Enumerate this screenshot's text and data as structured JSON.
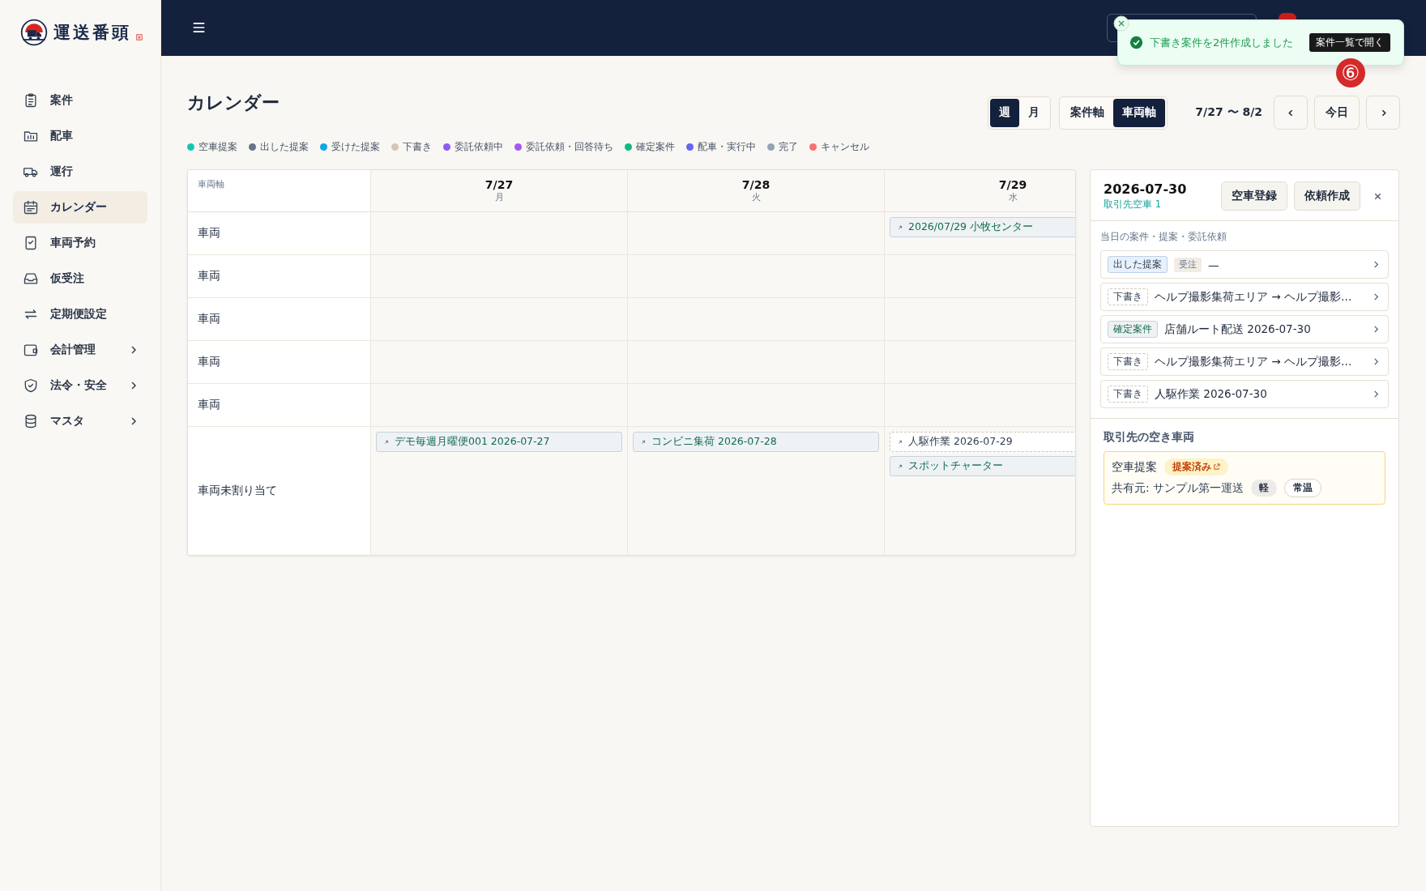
{
  "brand": {
    "name": "運送番頭"
  },
  "sidebar": {
    "items": [
      {
        "label": "案件",
        "kind": "clipboard",
        "selected": false,
        "expandable": false
      },
      {
        "label": "配車",
        "kind": "folder",
        "selected": false,
        "expandable": false
      },
      {
        "label": "運行",
        "kind": "truck",
        "selected": false,
        "expandable": false
      },
      {
        "label": "カレンダー",
        "kind": "calendar",
        "selected": true,
        "expandable": false
      },
      {
        "label": "車両予約",
        "kind": "check",
        "selected": false,
        "expandable": false
      },
      {
        "label": "仮受注",
        "kind": "inbox",
        "selected": false,
        "expandable": false
      },
      {
        "label": "定期便設定",
        "kind": "repeat",
        "selected": false,
        "expandable": false
      },
      {
        "label": "会計管理",
        "kind": "wallet",
        "selected": false,
        "expandable": true
      },
      {
        "label": "法令・安全",
        "kind": "shield",
        "selected": false,
        "expandable": true
      },
      {
        "label": "マスタ",
        "kind": "database",
        "selected": false,
        "expandable": true
      }
    ]
  },
  "toast": {
    "message": "下書き案件を2件作成しました",
    "action": "案件一覧で開く"
  },
  "step_marker": "⑥",
  "page": {
    "title": "カレンダー"
  },
  "view_toggle": [
    {
      "label": "週",
      "selected": true
    },
    {
      "label": "月",
      "selected": false
    }
  ],
  "axis_toggle": [
    {
      "label": "案件軸",
      "selected": false
    },
    {
      "label": "車両軸",
      "selected": true
    }
  ],
  "range": "7/27 〜 8/2",
  "today_button": "今日",
  "legend": [
    {
      "label": "空車提案",
      "color": "#14c8b0"
    },
    {
      "label": "出した提案",
      "color": "#64748b"
    },
    {
      "label": "受けた提案",
      "color": "#0ea5e9"
    },
    {
      "label": "下書き",
      "color": "#d6c7b4"
    },
    {
      "label": "委託依頼中",
      "color": "#8b5cf6"
    },
    {
      "label": "委託依頼・回答待ち",
      "color": "#a855f7"
    },
    {
      "label": "確定案件",
      "color": "#10b981"
    },
    {
      "label": "配車・実行中",
      "color": "#6366f1"
    },
    {
      "label": "完了",
      "color": "#94a3b8"
    },
    {
      "label": "キャンセル",
      "color": "#f87171"
    }
  ],
  "calendar": {
    "corner": "車両軸",
    "days": [
      {
        "date": "7/27",
        "weekday": "月"
      },
      {
        "date": "7/28",
        "weekday": "火"
      },
      {
        "date": "7/29",
        "weekday": "水"
      }
    ],
    "rows": [
      {
        "label": "車両",
        "tall": false,
        "cells": [
          [],
          [],
          [
            {
              "text": "2026/07/29 小牧センター",
              "kind": "case"
            }
          ]
        ]
      },
      {
        "label": "車両",
        "tall": false,
        "cells": [
          [],
          [],
          []
        ]
      },
      {
        "label": "車両",
        "tall": false,
        "cells": [
          [],
          [],
          []
        ]
      },
      {
        "label": "車両",
        "tall": false,
        "cells": [
          [],
          [],
          []
        ]
      },
      {
        "label": "車両",
        "tall": false,
        "cells": [
          [],
          [],
          []
        ]
      },
      {
        "label": "車両未割り当て",
        "tall": true,
        "cells": [
          [
            {
              "text": "デモ毎週月曜便001 2026-07-27",
              "kind": "case"
            }
          ],
          [
            {
              "text": "コンビニ集荷 2026-07-28",
              "kind": "case"
            }
          ],
          [
            {
              "text": "人駆作業 2026-07-29",
              "kind": "draft"
            },
            {
              "text": "スポットチャーター",
              "kind": "case"
            }
          ]
        ]
      }
    ]
  },
  "detail": {
    "date": "2026-07-30",
    "subtitle": "取引先空車 1",
    "buttons": [
      "空車登録",
      "依頼作成"
    ],
    "section": "当日の案件・提案・委託依頼",
    "items": [
      {
        "tag": "出した提案",
        "kind": "sent",
        "subtag": "受注",
        "text": "—"
      },
      {
        "tag": "下書き",
        "kind": "draft",
        "text": "ヘルプ撮影集荷エリア → ヘルプ撮影…"
      },
      {
        "tag": "確定案件",
        "kind": "confirmed",
        "text": "店舗ルート配送 2026-07-30"
      },
      {
        "tag": "下書き",
        "kind": "draft",
        "text": "ヘルプ撮影集荷エリア → ヘルプ撮影…"
      },
      {
        "tag": "下書き",
        "kind": "draft",
        "text": "人駆作業 2026-07-30"
      }
    ],
    "vacancy_title": "取引先の空き車両",
    "vacancy": {
      "title": "空車提案",
      "status": "提案済み",
      "owner": "共有元: サンプル第一運送",
      "tags": [
        {
          "label": "軽",
          "kind": "filled"
        },
        {
          "label": "常温",
          "kind": "outline"
        }
      ]
    }
  }
}
